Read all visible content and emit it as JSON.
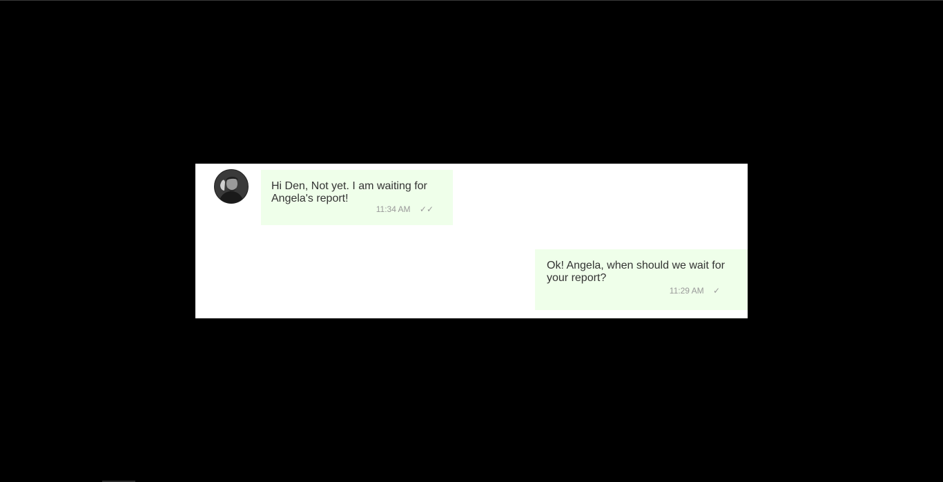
{
  "chat": {
    "messages": [
      {
        "direction": "incoming",
        "text": "Hi Den, Not yet. I am waiting for Angela's report!",
        "time": "11:34 AM",
        "status_icon": "double-check-icon",
        "status_glyph": "✓✓"
      },
      {
        "direction": "outgoing",
        "text": "Ok! Angela, when should we wait for your report?",
        "time": "11:29 AM",
        "status_icon": "check-icon",
        "status_glyph": "✓"
      }
    ]
  },
  "colors": {
    "page_background": "#000000",
    "panel_background": "#ffffff",
    "bubble_background": "#efffea",
    "message_text": "#333333",
    "meta_text": "#999999"
  }
}
